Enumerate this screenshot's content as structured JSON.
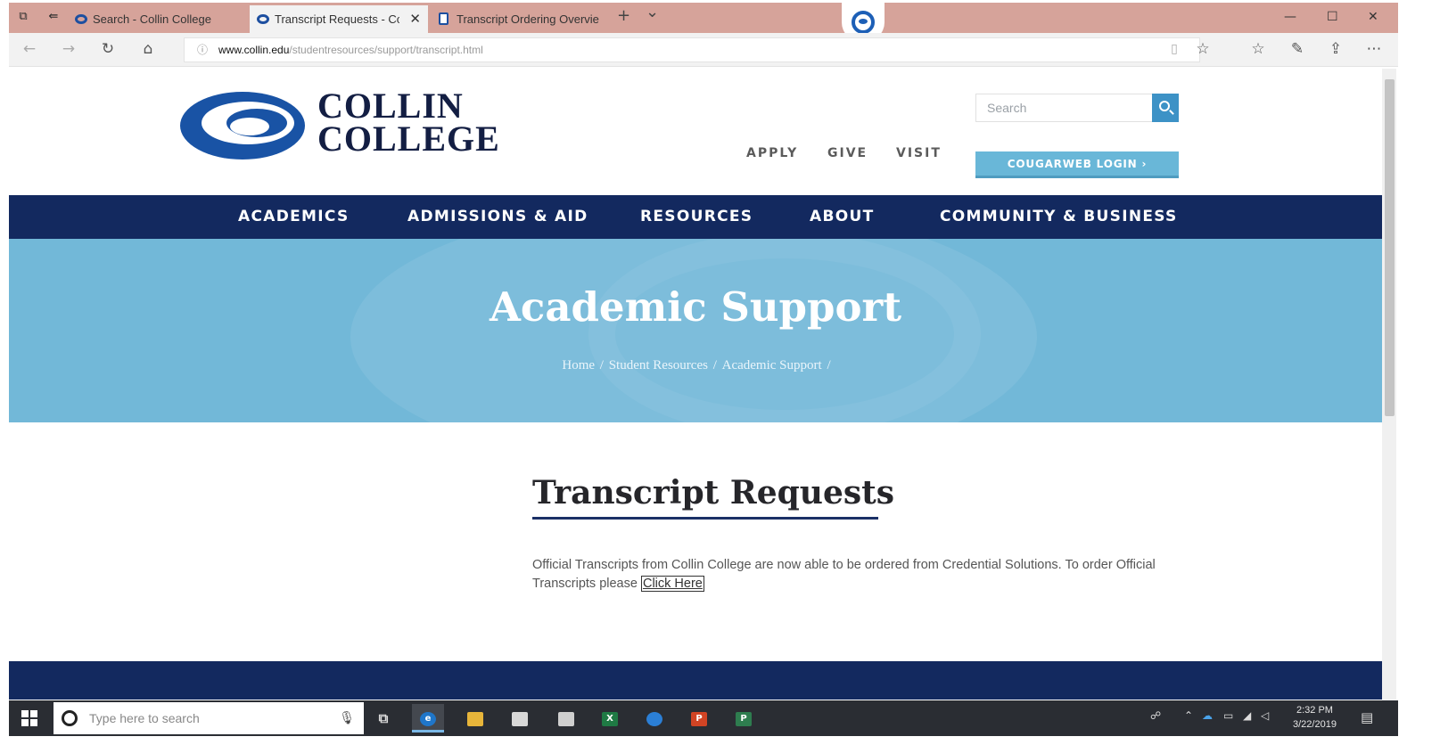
{
  "browser": {
    "tabs": [
      {
        "label": "Search - Collin College",
        "active": false
      },
      {
        "label": "Transcript Requests - Co",
        "active": true
      },
      {
        "label": "Transcript Ordering Overvie",
        "active": false
      }
    ],
    "new_tab": "+",
    "tab_dropdown": "⌄",
    "url_host": "www.collin.edu",
    "url_path": "/studentresources/support/transcript.html",
    "window_controls": [
      "—",
      "☐",
      "✕"
    ]
  },
  "site": {
    "logo_line1": "COLLIN",
    "logo_line2": "COLLEGE",
    "search_placeholder": "Search",
    "util_links": [
      "APPLY",
      "GIVE",
      "VISIT"
    ],
    "login_label": "COUGARWEB LOGIN ›",
    "nav": [
      "ACADEMICS",
      "ADMISSIONS & AID",
      "RESOURCES",
      "ABOUT",
      "COMMUNITY & BUSINESS"
    ],
    "hero_title": "Academic Support",
    "breadcrumb": [
      "Home",
      "Student Resources",
      "Academic Support"
    ],
    "page_title": "Transcript Requests",
    "body_text": "Official Transcripts from Collin College are now able to be ordered from Credential Solutions. To order Official Transcripts please ",
    "body_link": "Click Here"
  },
  "taskbar": {
    "search_placeholder": "Type here to search",
    "time": "2:32 PM",
    "date": "3/22/2019"
  },
  "colors": {
    "navy": "#13295f",
    "hero_blue": "#72b8d8",
    "login_blue": "#69b7d8",
    "tab_bar": "#d6a39a"
  }
}
